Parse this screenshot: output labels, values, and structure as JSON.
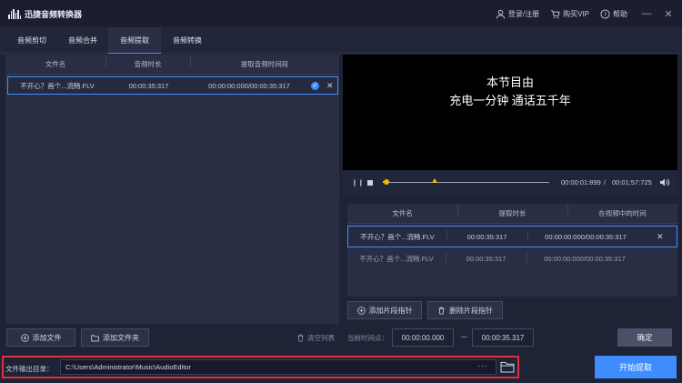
{
  "app": {
    "title": "迅捷音频转换器"
  },
  "topbar": {
    "login_label": "登录/注册",
    "vip_label": "购买VIP",
    "help_label": "帮助"
  },
  "tabs": [
    {
      "label": "音频剪切"
    },
    {
      "label": "音频合并"
    },
    {
      "label": "音频提取",
      "active": true
    },
    {
      "label": "音频转换"
    }
  ],
  "file_table": {
    "columns": [
      "文件名",
      "音频时长",
      "提取音频时间段"
    ],
    "rows": [
      {
        "name": "不开心？画个...流畅.FLV",
        "duration": "00:00:35:317",
        "segment": "00:00:00:000/00:00:35:317"
      }
    ]
  },
  "left_actions": {
    "add_file": "添加文件",
    "add_folder": "添加文件夹",
    "clear_list": "清空列表"
  },
  "video": {
    "subtitle_line1": "本节目由",
    "subtitle_line2": "充电一分钟  通话五千年",
    "current_time": "00:00:01:899",
    "separator": "/",
    "total_time": "00:01:57:725",
    "progress_fraction": 0.02
  },
  "segment_table": {
    "columns": [
      "文件名",
      "提取时长",
      "在视频中的时间"
    ],
    "rows": [
      {
        "name": "不开心？画个...流畅.FLV",
        "duration": "00:00:35:317",
        "range": "00:00:00:000/00:00:35:317"
      },
      {
        "name": "不开心？画个...流畅.FLV",
        "duration": "00:00:35:317",
        "range": "00:00:00:000/00:00:35:317"
      }
    ]
  },
  "segment_actions": {
    "add_marker": "添加片段指针",
    "delete_marker": "删除片段指针"
  },
  "time_point": {
    "label": "当前时间点：",
    "start": "00:00:00.000",
    "end": "00:00:35.317"
  },
  "confirm_label": "确定",
  "output": {
    "label": "文件输出目录：",
    "path": "C:\\Users\\Administrator\\Music\\AudioEditor",
    "more": "···"
  },
  "start_label": "开始提取",
  "colors": {
    "accent": "#3f8cff",
    "highlight": "#e0313b",
    "progress": "#f5b800"
  }
}
